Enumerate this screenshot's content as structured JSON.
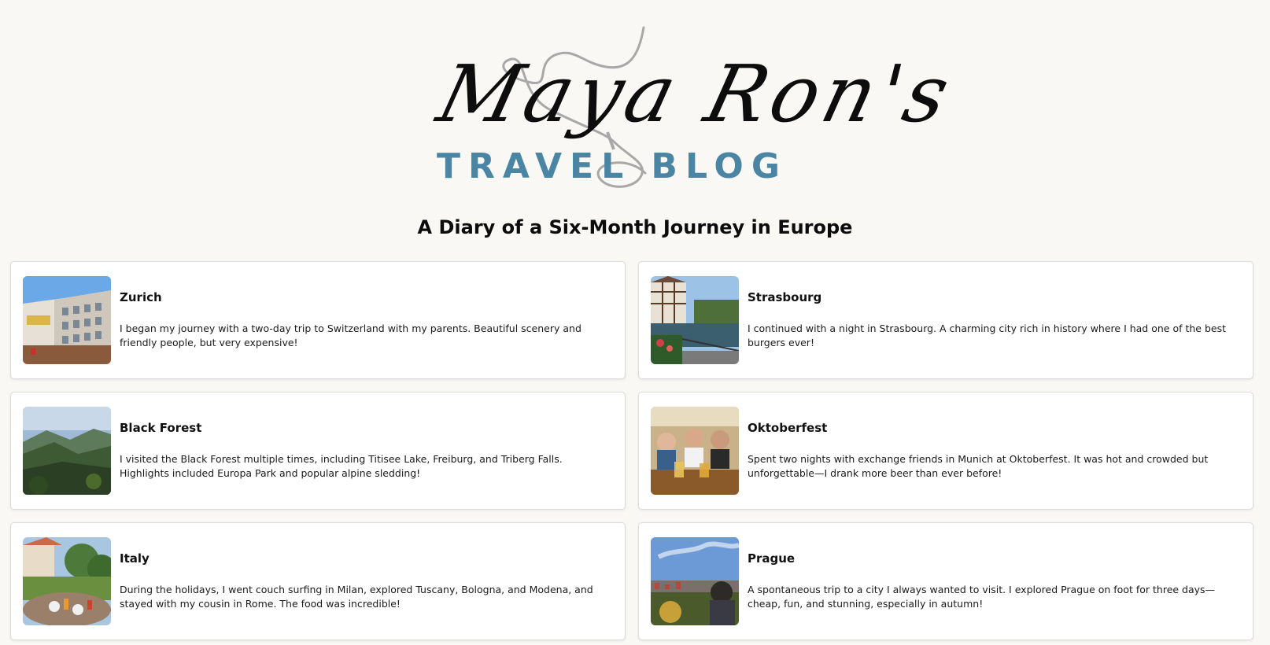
{
  "header": {
    "logo_script": "Maya Ron's",
    "logo_sub": "TRAVEL BLOG",
    "subtitle": "A Diary of a Six-Month Journey in Europe"
  },
  "colors": {
    "background": "#f9f8f5",
    "logo_accent": "#4a86a3",
    "card_bg": "#ffffff"
  },
  "cards": [
    {
      "title": "Zurich",
      "text": "I began my journey with a two-day trip to Switzerland with my parents. Beautiful scenery and friendly people, but very expensive!",
      "image": "zurich-street-photo"
    },
    {
      "title": "Strasbourg",
      "text": "I continued with a night in Strasbourg. A charming city rich in history where I had one of the best burgers ever!",
      "image": "strasbourg-canal-photo"
    },
    {
      "title": "Black Forest",
      "text": "I visited the Black Forest multiple times, including Titisee Lake, Freiburg, and Triberg Falls. Highlights included Europa Park and popular alpine sledding!",
      "image": "black-forest-valley-photo"
    },
    {
      "title": "Oktoberfest",
      "text": "Spent two nights with exchange friends in Munich at Oktoberfest. It was hot and crowded but unforgettable—I drank more beer than ever before!",
      "image": "oktoberfest-friends-photo"
    },
    {
      "title": "Italy",
      "text": "During the holidays, I went couch surfing in Milan, explored Tuscany, Bologna, and Modena, and stayed with my cousin in Rome. The food was incredible!",
      "image": "italy-garden-table-photo"
    },
    {
      "title": "Prague",
      "text": "A spontaneous trip to a city I always wanted to visit. I explored Prague on foot for three days—cheap, fun, and stunning, especially in autumn!",
      "image": "prague-view-photo"
    }
  ]
}
